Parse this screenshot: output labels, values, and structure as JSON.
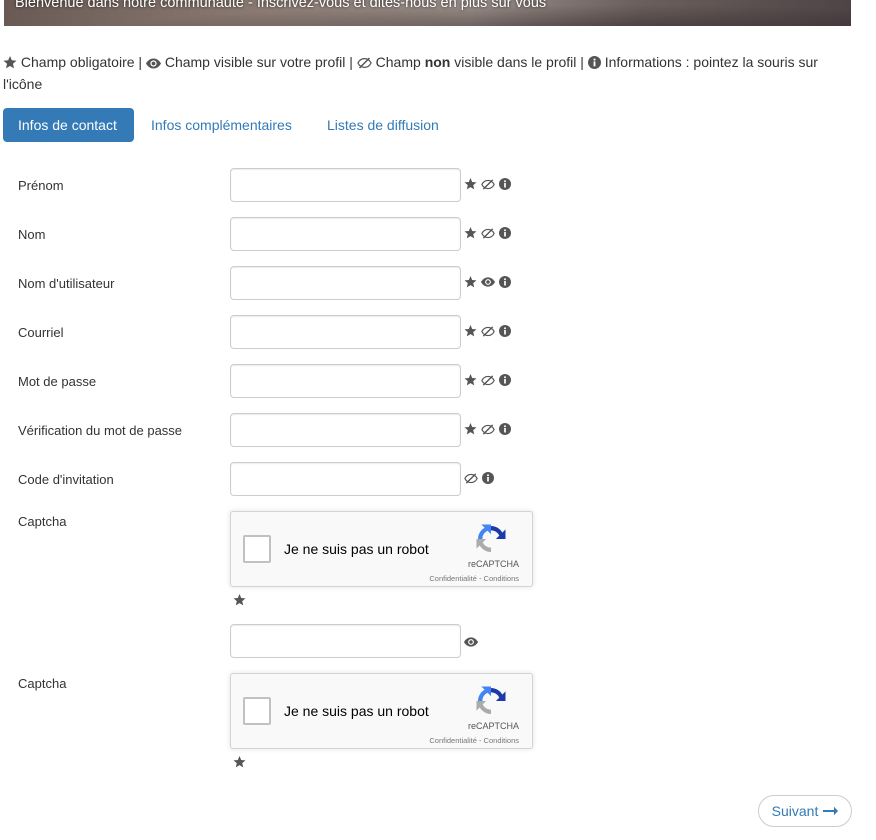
{
  "banner": {
    "text": "Bienvenue dans notre communauté - Inscrivez-vous et dites-nous en plus sur vous"
  },
  "legend": {
    "required": "Champ obligatoire |",
    "visible": "Champ visible sur votre profil |",
    "not_visible_prefix": "Champ",
    "not_visible_strong": "non",
    "not_visible_suffix": "visible dans le profil |",
    "info": "Informations : pointez la souris sur l'icône"
  },
  "tabs": [
    {
      "label": "Infos de contact",
      "active": true
    },
    {
      "label": "Infos complémentaires",
      "active": false
    },
    {
      "label": "Listes de diffusion",
      "active": false
    }
  ],
  "form": {
    "fields": [
      {
        "label": "Prénom",
        "value": "",
        "icons": [
          "star-icon",
          "eye-slash-icon",
          "info-icon"
        ]
      },
      {
        "label": "Nom",
        "value": "",
        "icons": [
          "star-icon",
          "eye-slash-icon",
          "info-icon"
        ]
      },
      {
        "label": "Nom d'utilisateur",
        "value": "",
        "icons": [
          "star-icon",
          "eye-icon",
          "info-icon"
        ]
      },
      {
        "label": "Courriel",
        "value": "",
        "icons": [
          "star-icon",
          "eye-slash-icon",
          "info-icon"
        ]
      },
      {
        "label": "Mot de passe",
        "value": "",
        "icons": [
          "star-icon",
          "eye-slash-icon",
          "info-icon"
        ]
      },
      {
        "label": "Vérification du mot de passe",
        "value": "",
        "icons": [
          "star-icon",
          "eye-slash-icon",
          "info-icon"
        ]
      },
      {
        "label": "Code d'invitation",
        "value": "",
        "icons": [
          "eye-slash-icon",
          "info-icon"
        ]
      }
    ],
    "captcha1": {
      "label": "Captcha"
    },
    "extra_field": {
      "value": "",
      "icons": [
        "eye-icon"
      ]
    },
    "captcha2": {
      "label": "Captcha"
    }
  },
  "recaptcha": {
    "checkbox_label": "Je ne suis pas un robot",
    "brand": "reCAPTCHA",
    "terms": "Confidentialité - Conditions"
  },
  "next_button": {
    "label": "Suivant",
    "icon": "arrow-right-icon"
  },
  "colors": {
    "accent": "#337ab7",
    "icon_gray": "#555555",
    "input_border": "#cccccc",
    "recaptcha_bg": "#f9f9f9"
  }
}
